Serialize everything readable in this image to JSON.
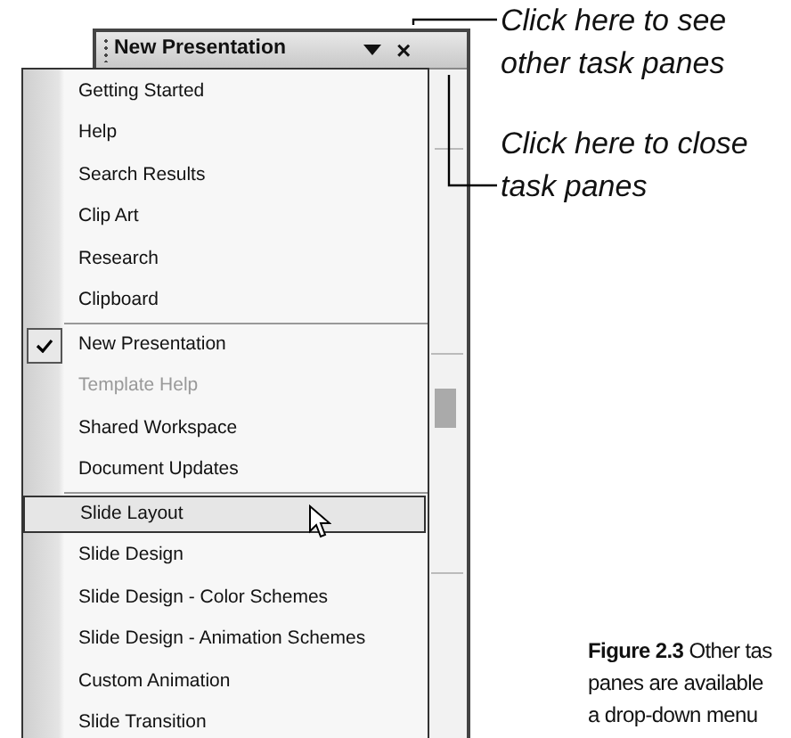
{
  "task_pane": {
    "title": "New Presentation",
    "close": "×"
  },
  "menu": {
    "groups": [
      [
        {
          "label": "Getting Started",
          "checked": false,
          "disabled": false,
          "selected": false
        },
        {
          "label": "Help",
          "checked": false,
          "disabled": false,
          "selected": false
        },
        {
          "label": "Search Results",
          "checked": false,
          "disabled": false,
          "selected": false
        },
        {
          "label": "Clip Art",
          "checked": false,
          "disabled": false,
          "selected": false
        },
        {
          "label": "Research",
          "checked": false,
          "disabled": false,
          "selected": false
        },
        {
          "label": "Clipboard",
          "checked": false,
          "disabled": false,
          "selected": false
        }
      ],
      [
        {
          "label": "New Presentation",
          "checked": true,
          "disabled": false,
          "selected": false
        },
        {
          "label": "Template Help",
          "checked": false,
          "disabled": true,
          "selected": false
        },
        {
          "label": "Shared Workspace",
          "checked": false,
          "disabled": false,
          "selected": false
        },
        {
          "label": "Document Updates",
          "checked": false,
          "disabled": false,
          "selected": false
        }
      ],
      [
        {
          "label": "Slide Layout",
          "checked": false,
          "disabled": false,
          "selected": true
        },
        {
          "label": "Slide Design",
          "checked": false,
          "disabled": false,
          "selected": false
        },
        {
          "label": "Slide Design - Color Schemes",
          "checked": false,
          "disabled": false,
          "selected": false
        },
        {
          "label": "Slide Design - Animation Schemes",
          "checked": false,
          "disabled": false,
          "selected": false
        },
        {
          "label": "Custom Animation",
          "checked": false,
          "disabled": false,
          "selected": false
        },
        {
          "label": "Slide Transition",
          "checked": false,
          "disabled": false,
          "selected": false
        }
      ]
    ]
  },
  "callouts": [
    {
      "lines": [
        "Click here to see",
        "other task panes"
      ]
    },
    {
      "lines": [
        "Click here to close",
        "task panes"
      ]
    }
  ],
  "caption": [
    "**Figure 2.3** Other tas",
    "panes are available",
    "a drop-down menu"
  ]
}
